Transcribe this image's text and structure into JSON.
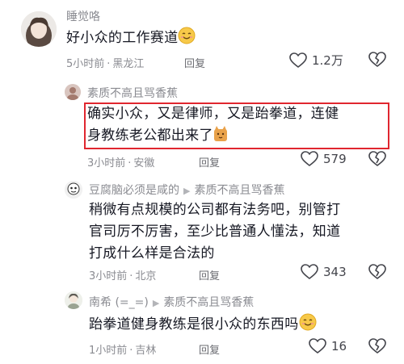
{
  "comments": [
    {
      "author": "睡觉咯",
      "lines": [
        "好小众的工作赛道"
      ],
      "emoji": "smile-emoji",
      "time": "5小时前",
      "location": "黑龙江",
      "reply_label": "回复",
      "likes": "1.2万"
    },
    {
      "author": "素质不高且骂香蕉",
      "lines": [
        "确实小众，又是律师，又是跆拳道，连健",
        "身教练老公都出来了"
      ],
      "emoji": "cat-emoji",
      "time": "3小时前",
      "location": "安徽",
      "reply_label": "回复",
      "likes": "579",
      "highlight_color": "#e0262f"
    },
    {
      "author": "豆腐脑必须是咸的",
      "reply_to": "素质不高且骂香蕉",
      "lines": [
        "稍微有点规模的公司都有法务吧，别管打",
        "官司厉不厉害，至少比普通人懂法，知道",
        "打成什么样是合法的"
      ],
      "time": "3小时前",
      "location": "北京",
      "reply_label": "回复",
      "likes": "343"
    },
    {
      "author": "南希 (=_=)",
      "reply_to": "素质不高且骂香蕉",
      "lines": [
        "跆拳道健身教练是很小众的东西吗"
      ],
      "emoji": "smile-emoji",
      "time": "1小时前",
      "location": "吉林",
      "reply_label": "回复",
      "likes": "16"
    }
  ],
  "icons": {
    "like": "heart-icon",
    "dislike": "broken-heart-icon",
    "reply_arrow": "triangle-right-icon"
  },
  "colors": {
    "text": "#161823",
    "muted": "#8a8b91",
    "highlight": "#e0262f"
  }
}
